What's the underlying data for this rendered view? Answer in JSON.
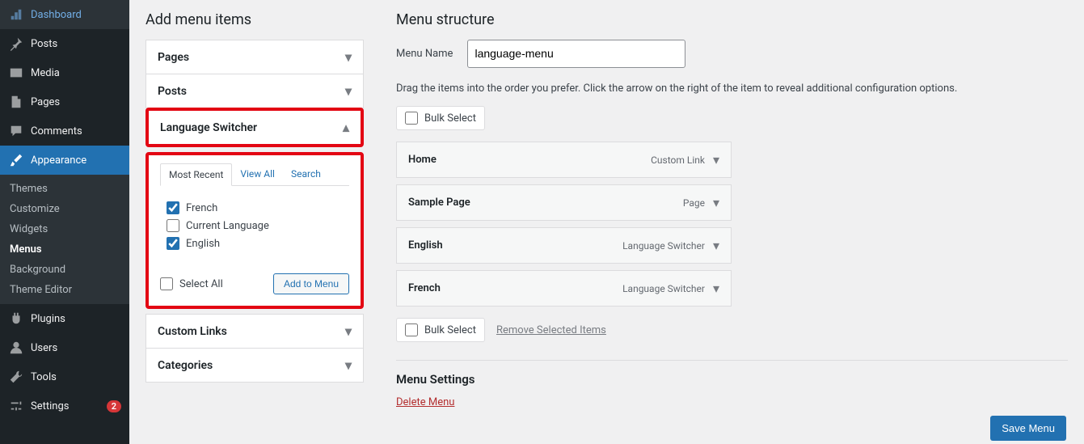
{
  "sidebar": {
    "items": [
      {
        "icon": "dashboard",
        "label": "Dashboard"
      },
      {
        "icon": "pin",
        "label": "Posts"
      },
      {
        "icon": "media",
        "label": "Media"
      },
      {
        "icon": "page",
        "label": "Pages"
      },
      {
        "icon": "comment",
        "label": "Comments"
      },
      {
        "icon": "brush",
        "label": "Appearance",
        "active": true
      },
      {
        "icon": "plugin",
        "label": "Plugins"
      },
      {
        "icon": "user",
        "label": "Users"
      },
      {
        "icon": "wrench",
        "label": "Tools"
      },
      {
        "icon": "sliders",
        "label": "Settings",
        "badge": "2"
      }
    ],
    "sub": [
      "Themes",
      "Customize",
      "Widgets",
      "Menus",
      "Background",
      "Theme Editor"
    ],
    "sub_current": "Menus"
  },
  "add": {
    "title": "Add menu items",
    "panels": [
      "Pages",
      "Posts",
      "Language Switcher",
      "Custom Links",
      "Categories"
    ],
    "tabs": [
      "Most Recent",
      "View All",
      "Search"
    ],
    "languages": [
      {
        "label": "French",
        "checked": true
      },
      {
        "label": "Current Language",
        "checked": false
      },
      {
        "label": "English",
        "checked": true
      }
    ],
    "select_all": "Select All",
    "add_btn": "Add to Menu"
  },
  "structure": {
    "title": "Menu structure",
    "name_label": "Menu Name",
    "name_value": "language-menu",
    "help": "Drag the items into the order you prefer. Click the arrow on the right of the item to reveal additional configuration options.",
    "bulk_label": "Bulk Select",
    "remove_label": "Remove Selected Items",
    "items": [
      {
        "title": "Home",
        "type": "Custom Link"
      },
      {
        "title": "Sample Page",
        "type": "Page"
      },
      {
        "title": "English",
        "type": "Language Switcher"
      },
      {
        "title": "French",
        "type": "Language Switcher"
      }
    ],
    "settings_title": "Menu Settings",
    "delete": "Delete Menu",
    "save": "Save Menu"
  }
}
